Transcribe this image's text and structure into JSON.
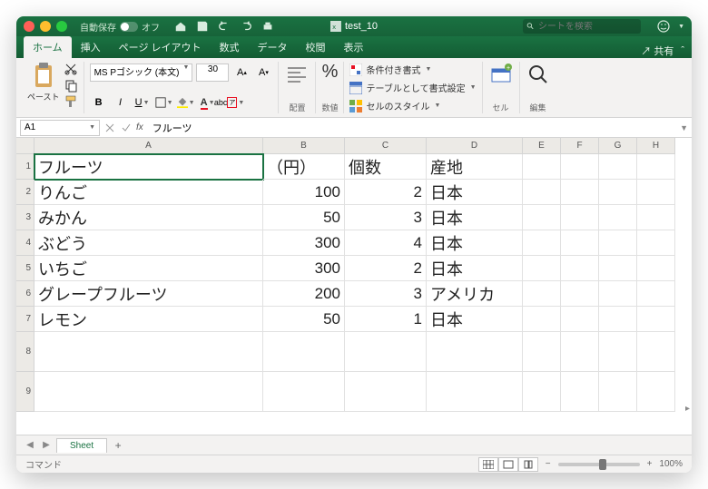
{
  "titlebar": {
    "autosave_label": "自動保存",
    "autosave_state": "オフ",
    "filename": "test_10",
    "search_placeholder": "シートを検索"
  },
  "tabs": {
    "home": "ホーム",
    "insert": "挿入",
    "layout": "ページ レイアウト",
    "formulas": "数式",
    "data": "データ",
    "review": "校閲",
    "view": "表示",
    "share": "共有"
  },
  "ribbon": {
    "paste": "ペースト",
    "font_name": "MS Pゴシック (本文)",
    "font_size": "30",
    "alignment": "配置",
    "number": "数値",
    "percent": "%",
    "cond_format": "条件付き書式",
    "table_format": "テーブルとして書式設定",
    "cell_styles": "セルのスタイル",
    "cell": "セル",
    "edit": "編集"
  },
  "cellref": {
    "name": "A1",
    "formula": "フルーツ"
  },
  "columns": [
    "A",
    "B",
    "C",
    "D",
    "E",
    "F",
    "G",
    "H"
  ],
  "rows": [
    "1",
    "2",
    "3",
    "4",
    "5",
    "6",
    "7",
    "8",
    "9"
  ],
  "chart_data": {
    "type": "table",
    "headers": [
      "フルーツ",
      "（円）",
      "個数",
      "産地"
    ],
    "rows": [
      [
        "りんご",
        100,
        2,
        "日本"
      ],
      [
        "みかん",
        50,
        3,
        "日本"
      ],
      [
        "ぶどう",
        300,
        4,
        "日本"
      ],
      [
        "いちご",
        300,
        2,
        "日本"
      ],
      [
        "グレープフルーツ",
        200,
        3,
        "アメリカ"
      ],
      [
        "レモン",
        50,
        1,
        "日本"
      ]
    ]
  },
  "sheet": {
    "name": "Sheet"
  },
  "status": {
    "mode": "コマンド",
    "zoom": "100%"
  }
}
